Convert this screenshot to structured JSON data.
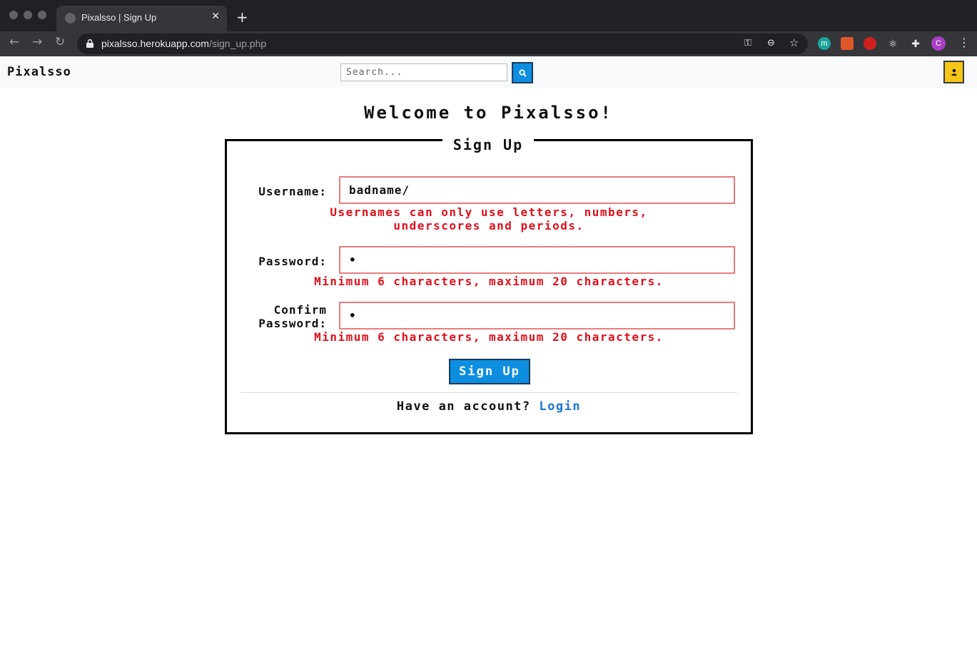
{
  "browser": {
    "tab_title": "Pixalsso | Sign Up",
    "close_glyph": "✕",
    "new_tab_glyph": "+",
    "url_host": "pixalsso.herokuapp.com",
    "url_path": "/sign_up.php",
    "profile_initial": "C",
    "extension_initial": "m",
    "icons": [
      "globe-icon",
      "back-arrow-icon",
      "forward-arrow-icon",
      "reload-icon",
      "lock-icon",
      "key-icon",
      "zoom-out-icon",
      "star-icon",
      "puzzle-icon",
      "kebab-menu-icon"
    ]
  },
  "navbar": {
    "brand": "Pixalsso",
    "search_placeholder": "Search...",
    "search_icon": "search-icon",
    "user_icon": "user-icon",
    "accent_color": "#0d8ee0",
    "user_button_color": "#f5c518"
  },
  "main": {
    "title": "Welcome to Pixalsso!",
    "form_title": "Sign Up",
    "username": {
      "label": "Username:",
      "value": "badname/",
      "error_line1": "Usernames can only use letters, numbers,",
      "error_line2": "underscores and periods."
    },
    "password": {
      "label": "Password:",
      "value": "•",
      "error": "Minimum 6 characters, maximum 20 characters."
    },
    "confirm": {
      "label_line1": "Confirm",
      "label_line2": "Password:",
      "value": "•",
      "error": "Minimum 6 characters, maximum 20 characters."
    },
    "submit_label": "Sign Up",
    "footer_prompt": "Have an account?",
    "login_label": "Login",
    "error_color": "#e0101c",
    "field_border_color": "#e97c7c"
  }
}
